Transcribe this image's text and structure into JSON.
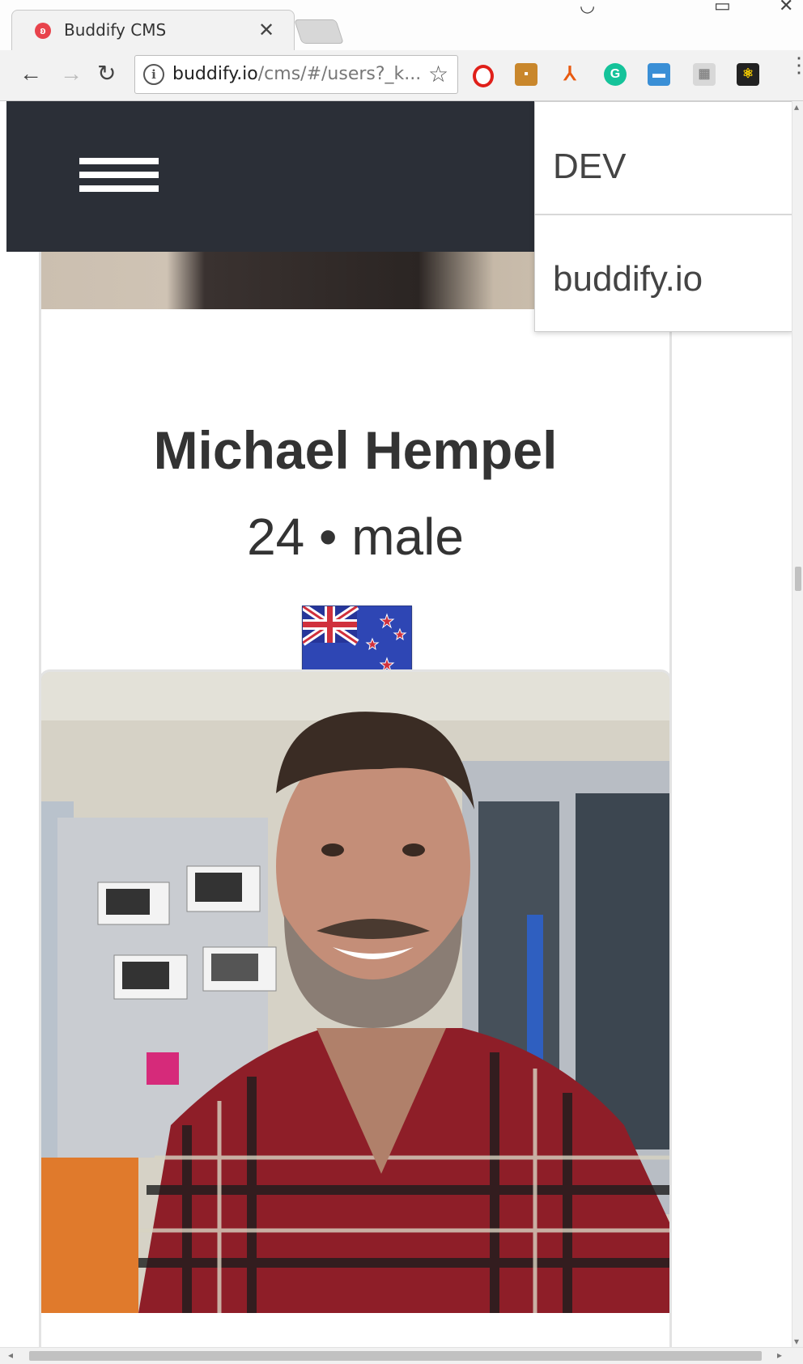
{
  "browser": {
    "tab_title": "Buddify CMS",
    "tab_favicon": "buddify-logo-icon",
    "url_host": "buddify.io",
    "url_path": "/cms/#/users?_k...",
    "extensions": [
      "opera-icon",
      "extension-icon",
      "arrow-extension-icon",
      "grammarly-icon",
      "window-extension-icon",
      "grid-extension-icon",
      "react-devtools-icon"
    ]
  },
  "app": {
    "menu_icon": "hamburger-menu-icon",
    "dropdown": {
      "items": [
        {
          "label": "DEV"
        },
        {
          "label": "buddify.io"
        }
      ]
    }
  },
  "users": [
    {
      "name": "Michael Hempel",
      "age_gender": "24 • male",
      "flag": "new-zealand-flag"
    },
    {
      "photo": "user-photo"
    }
  ],
  "colors": {
    "appbar": "#2b2f37",
    "text": "#333333",
    "brand": "#e8434c"
  }
}
